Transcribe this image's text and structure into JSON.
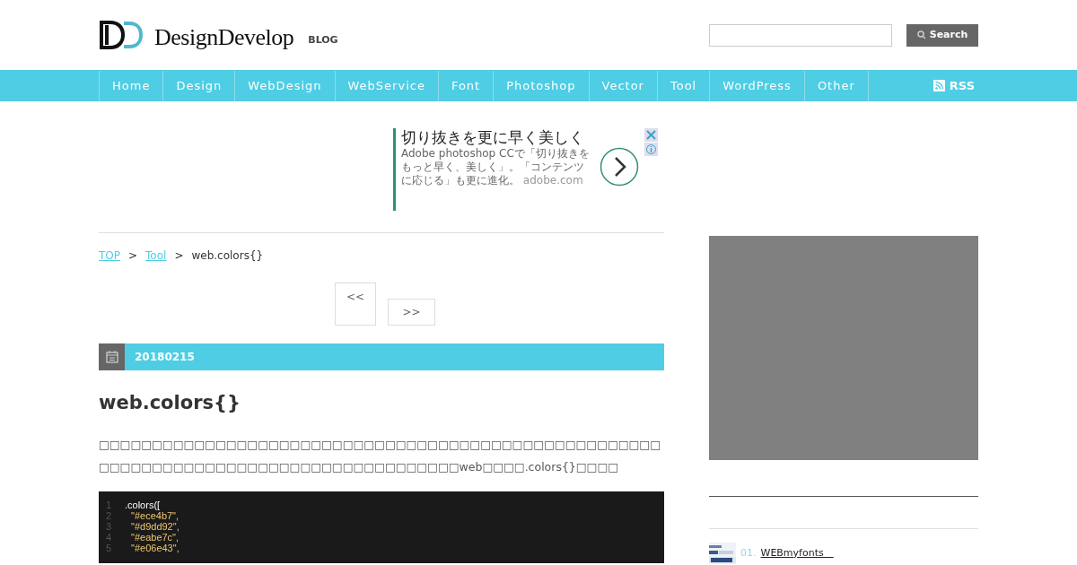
{
  "header": {
    "logo": "DesignDevelop",
    "logo_sub": "BLOG",
    "search": {
      "button": "Search"
    }
  },
  "nav": [
    {
      "label": "Home"
    },
    {
      "label": "Design"
    },
    {
      "label": "WebDesign"
    },
    {
      "label": "WebService"
    },
    {
      "label": "Font"
    },
    {
      "label": "Photoshop"
    },
    {
      "label": "Vector"
    },
    {
      "label": "Tool"
    },
    {
      "label": "WordPress"
    },
    {
      "label": "Other"
    }
  ],
  "rss": "RSS",
  "ad": {
    "headline": "切り抜きを更に早く美しく",
    "body": "Adobe photoshop CCで「切り抜きをもっと早く、美しく」。「コンテンツに応じる」も更に進化。",
    "domain": "adobe.com"
  },
  "breadcrumb": [
    {
      "label": "TOP",
      "kind": "link"
    },
    {
      "label": ">",
      "kind": "sep"
    },
    {
      "label": "Tool",
      "kind": "link"
    },
    {
      "label": ">",
      "kind": "sep"
    },
    {
      "label": "web.colors{}",
      "kind": "current"
    }
  ],
  "pager": {
    "prev": "<<",
    "next": ">>"
  },
  "date": "20180215",
  "title": "web.colors{}",
  "paragraph": "□□□□□□□□□□□□□□□□□□□□□□□□□□□□□□□□□□□□□□□□□□□□□□□□□□□□□□□□□□□□□□□□□□□□□□□□□□□□□□□□□□□□□□□web□□□□.colors{}□□□□",
  "code": [
    {
      "num": "1",
      "text": ".colors([",
      "kind": "plain"
    },
    {
      "num": "2",
      "text": "\"#ece4b7\",",
      "kind": "string"
    },
    {
      "num": "3",
      "text": "\"#d9dd92\",",
      "kind": "string"
    },
    {
      "num": "4",
      "text": "\"#eabe7c\",",
      "kind": "string"
    },
    {
      "num": "5",
      "text": "\"#e06e43\",",
      "kind": "string"
    }
  ],
  "sidebar": {
    "ranking": [
      {
        "rank": "01.",
        "title": "WEBmyfonts　"
      }
    ]
  }
}
